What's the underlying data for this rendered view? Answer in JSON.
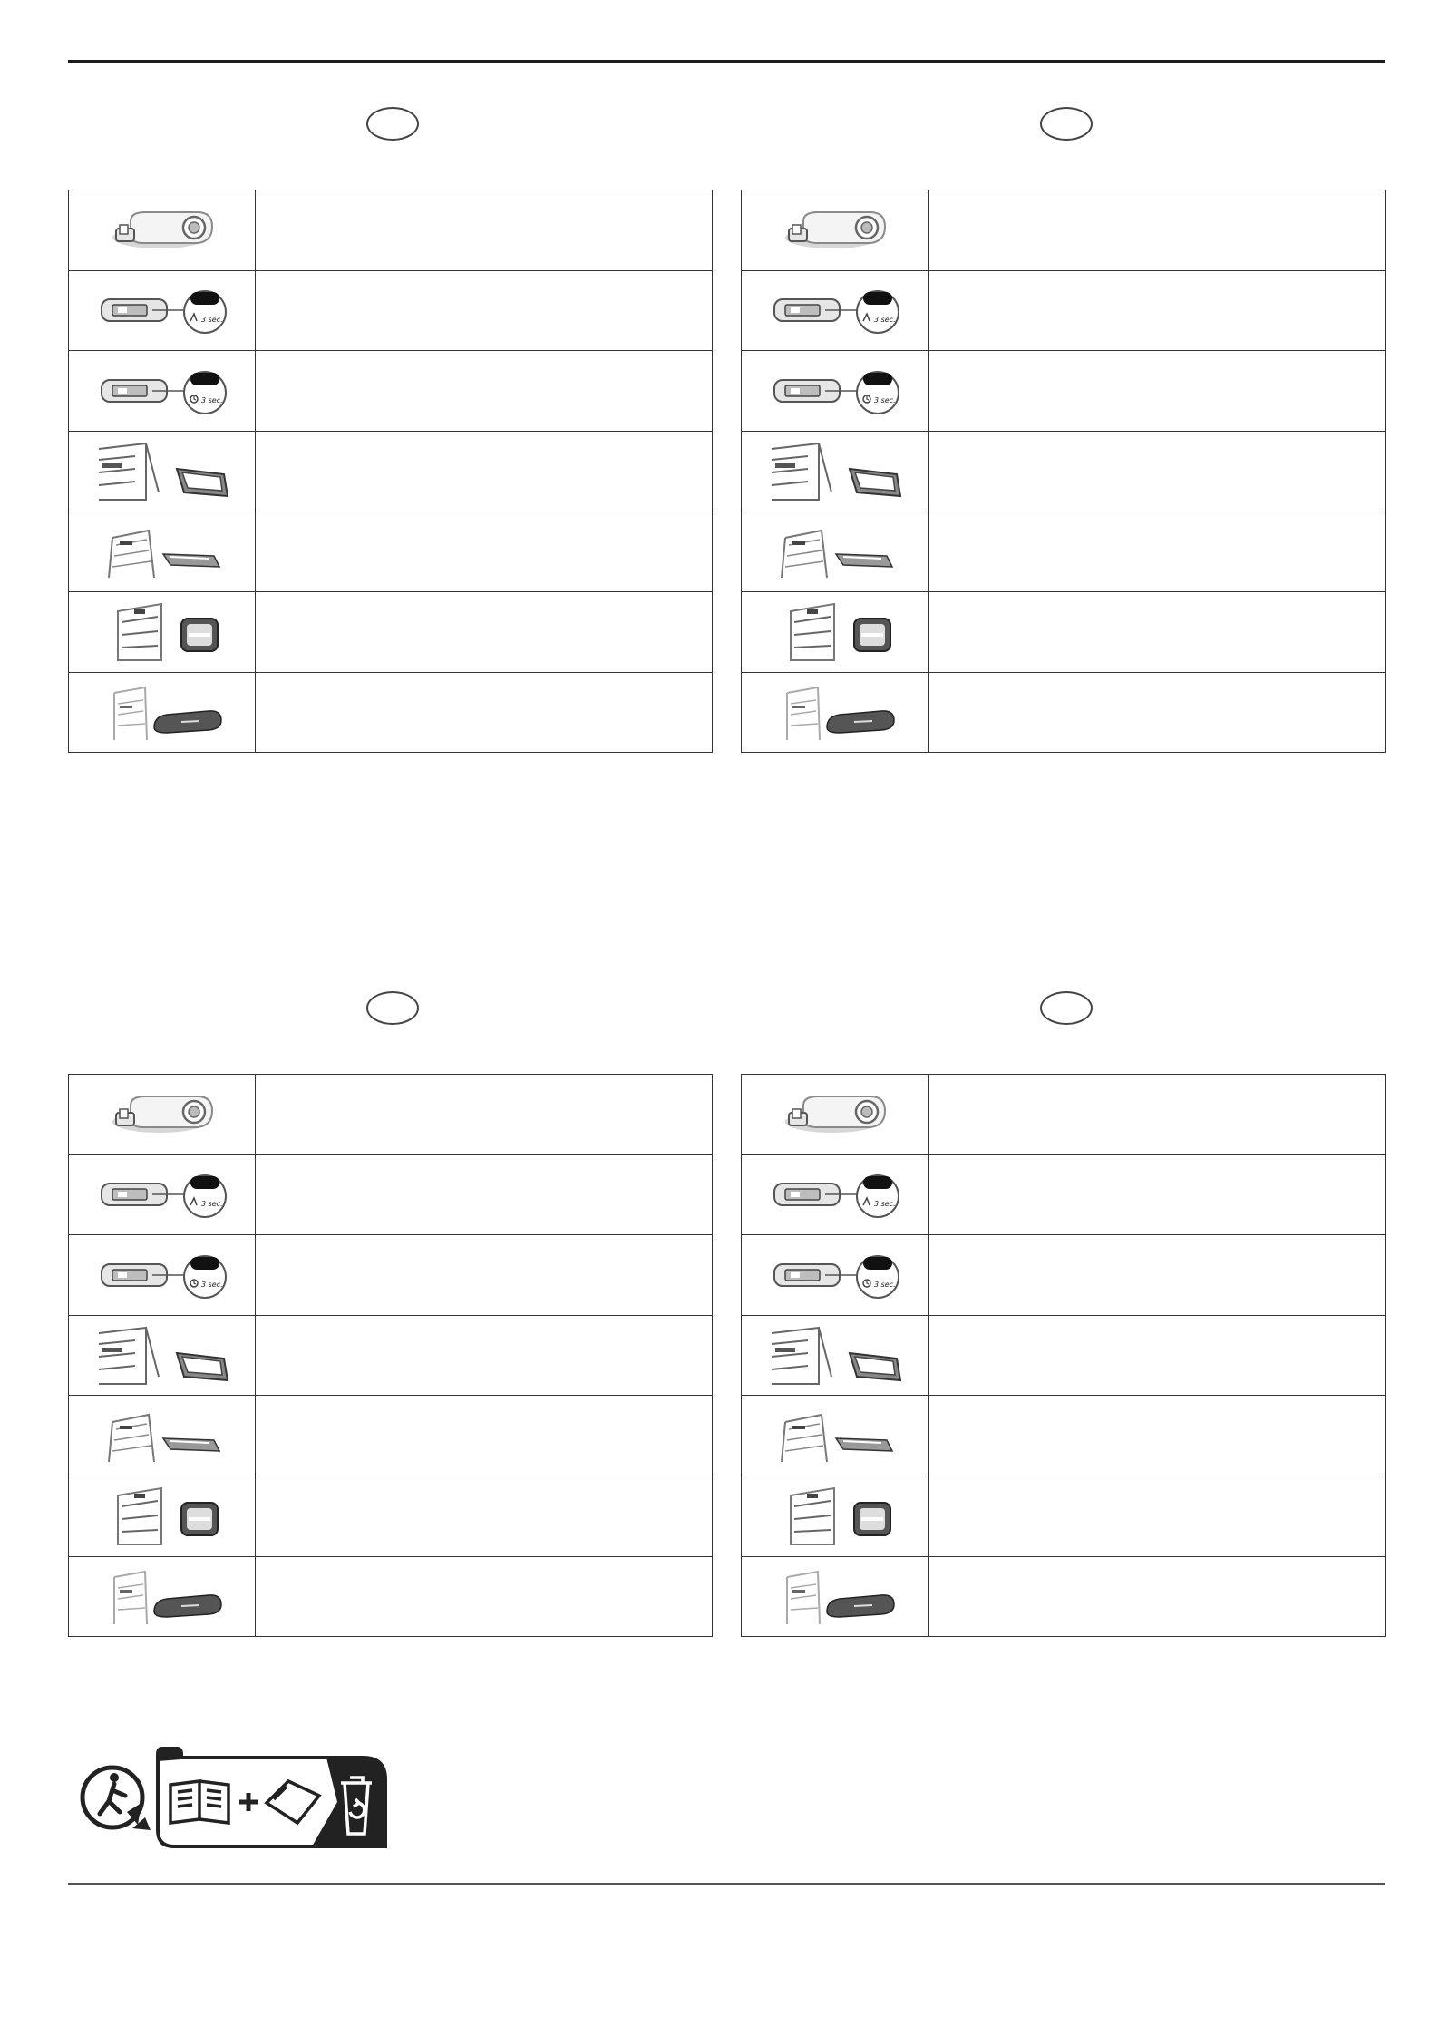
{
  "panels": [
    {
      "lang_code": "",
      "rows": [
        {
          "icon": "led-lamp-icon",
          "text": ""
        },
        {
          "icon": "control-panel-press-3sec-icon",
          "text": ""
        },
        {
          "icon": "control-panel-timer-3sec-icon",
          "text": ""
        },
        {
          "icon": "fridge-light-cover-icon",
          "text": ""
        },
        {
          "icon": "fridge-diffuser-icon",
          "text": ""
        },
        {
          "icon": "fridge-square-lamp-icon",
          "text": ""
        },
        {
          "icon": "fridge-bar-lamp-icon",
          "text": ""
        }
      ]
    },
    {
      "lang_code": "",
      "rows": [
        {
          "icon": "led-lamp-icon",
          "text": ""
        },
        {
          "icon": "control-panel-press-3sec-icon",
          "text": ""
        },
        {
          "icon": "control-panel-timer-3sec-icon",
          "text": ""
        },
        {
          "icon": "fridge-light-cover-icon",
          "text": ""
        },
        {
          "icon": "fridge-diffuser-icon",
          "text": ""
        },
        {
          "icon": "fridge-square-lamp-icon",
          "text": ""
        },
        {
          "icon": "fridge-bar-lamp-icon",
          "text": ""
        }
      ]
    },
    {
      "lang_code": "",
      "rows": [
        {
          "icon": "led-lamp-icon",
          "text": ""
        },
        {
          "icon": "control-panel-press-3sec-icon",
          "text": ""
        },
        {
          "icon": "control-panel-timer-3sec-icon",
          "text": ""
        },
        {
          "icon": "fridge-light-cover-icon",
          "text": ""
        },
        {
          "icon": "fridge-diffuser-icon",
          "text": ""
        },
        {
          "icon": "fridge-square-lamp-icon",
          "text": ""
        },
        {
          "icon": "fridge-bar-lamp-icon",
          "text": ""
        }
      ]
    },
    {
      "lang_code": "",
      "rows": [
        {
          "icon": "led-lamp-icon",
          "text": ""
        },
        {
          "icon": "control-panel-press-3sec-icon",
          "text": ""
        },
        {
          "icon": "control-panel-timer-3sec-icon",
          "text": ""
        },
        {
          "icon": "fridge-light-cover-icon",
          "text": ""
        },
        {
          "icon": "fridge-diffuser-icon",
          "text": ""
        },
        {
          "icon": "fridge-square-lamp-icon",
          "text": ""
        },
        {
          "icon": "fridge-bar-lamp-icon",
          "text": ""
        }
      ]
    }
  ],
  "callouts": {
    "seconds_label": "3 sec."
  },
  "recycling": {
    "icons": [
      "triman-icon",
      "booklet-icon",
      "plus-icon",
      "envelope-icon",
      "recycle-bin-icon"
    ]
  }
}
